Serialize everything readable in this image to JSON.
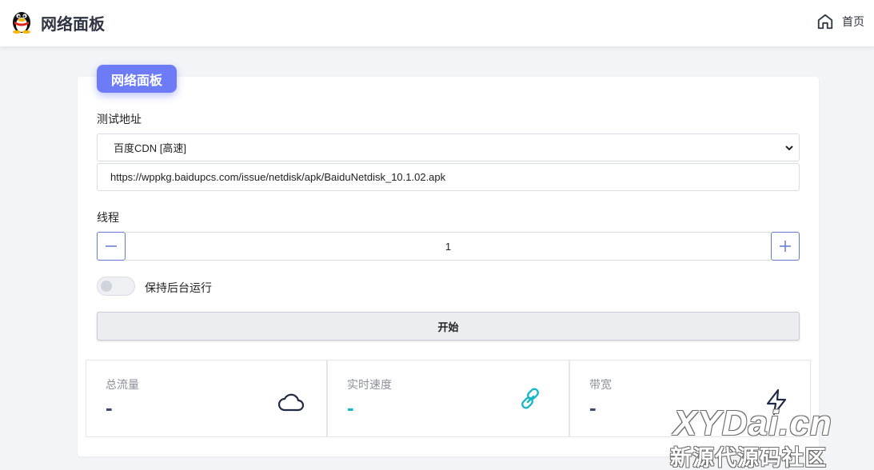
{
  "header": {
    "title": "网络面板",
    "logo_icon": "qq-penguin-icon",
    "home_label": "首页",
    "home_icon": "home-icon"
  },
  "panel": {
    "tag": "网络面板",
    "test_address_label": "测试地址",
    "source_select": {
      "selected": "百度CDN [高速]"
    },
    "url_input": {
      "value": "https://wppkg.baidupcs.com/issue/netdisk/apk/BaiduNetdisk_10.1.02.apk"
    },
    "threads_label": "线程",
    "threads_value": "1",
    "keep_background": {
      "label": "保持后台运行",
      "enabled": false
    },
    "start_button": "开始"
  },
  "stats": [
    {
      "label": "总流量",
      "value": "-",
      "icon": "cloud-icon",
      "value_color": "#3b4a6b"
    },
    {
      "label": "实时速度",
      "value": "-",
      "icon": "link-icon",
      "value_color": "#17b8c8"
    },
    {
      "label": "带宽",
      "value": "-",
      "icon": "lightning-icon",
      "value_color": "#3b4a6b"
    }
  ],
  "colors": {
    "accent": "#6d7cf6",
    "stepper_border": "#6378d8",
    "link_icon": "#17b8c8"
  },
  "watermark": {
    "line1": "XYDai.cn",
    "line2": "新源代源码社区"
  }
}
